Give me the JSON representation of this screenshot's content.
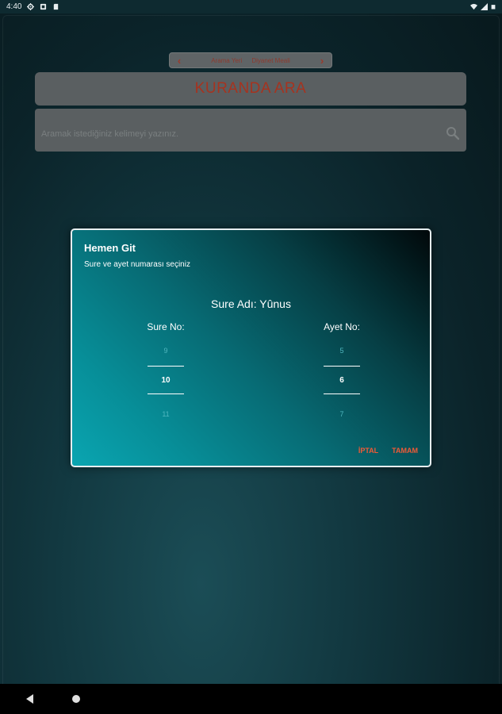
{
  "status_bar": {
    "time": "4:40",
    "left_icons": [
      "gear-icon",
      "sim-icon",
      "sd-card-icon"
    ],
    "right_icons": [
      "wifi-icon",
      "signal-icon",
      "battery-icon"
    ]
  },
  "header": {
    "left_label": "Arama Yeri",
    "right_label": "Diyanet Meali"
  },
  "title": "KURANDA ARA",
  "search": {
    "placeholder": "Aramak istediğiniz kelimeyi yazınız."
  },
  "dialog": {
    "title": "Hemen Git",
    "subtitle": "Sure ve ayet numarası seçiniz",
    "sure_name": "Sure Adı: Yûnus",
    "sure_picker": {
      "label": "Sure No:",
      "prev": "9",
      "current": "10",
      "next": "11"
    },
    "ayet_picker": {
      "label": "Ayet No:",
      "prev": "5",
      "current": "6",
      "next": "7"
    },
    "cancel_label": "İPTAL",
    "ok_label": "TAMAM"
  },
  "colors": {
    "accent_red": "#a6331f",
    "action_orange": "#f05a36",
    "dialog_teal": "#0aa5b1"
  }
}
